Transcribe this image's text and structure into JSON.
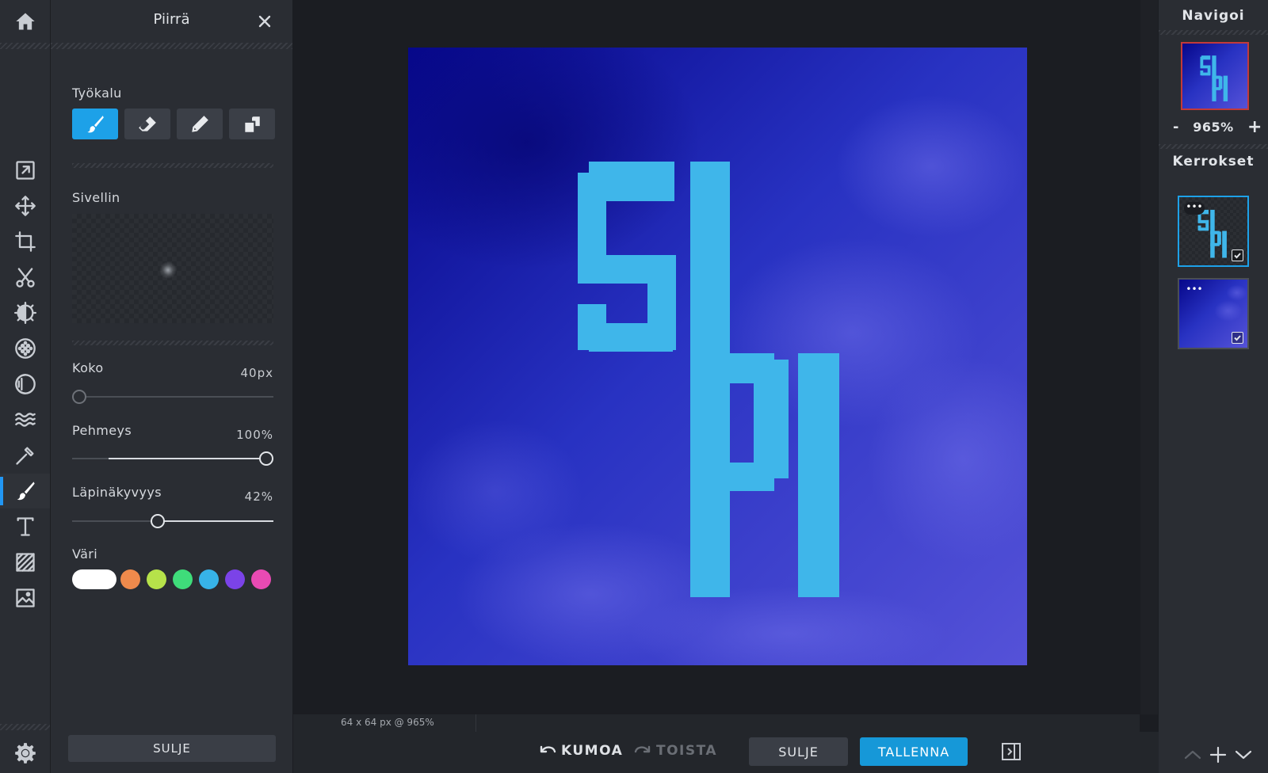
{
  "panel": {
    "title": "Piirrä",
    "tool_label": "Työkalu",
    "brush_label": "Sivellin",
    "size_label": "Koko",
    "size_value": "40px",
    "size_fraction": 0.0,
    "softness_label": "Pehmeys",
    "softness_value": "100%",
    "softness_fraction": 1.0,
    "opacity_label": "Läpinäkyvyys",
    "opacity_value": "42%",
    "opacity_fraction": 0.42,
    "color_label": "Väri",
    "colors": [
      "#ffffff",
      "#ef8a4c",
      "#b6e24a",
      "#3fdc7a",
      "#37b3e8",
      "#7b43e8",
      "#e94ab3"
    ],
    "close_button": "SULJE"
  },
  "toolbar": {
    "active_tool": "draw",
    "items": [
      "home-icon",
      "export-icon",
      "move-icon",
      "crop-icon",
      "cut-icon",
      "adjust-icon",
      "filter-icon",
      "effect-icon",
      "liquify-icon",
      "retouch-icon",
      "draw-icon",
      "text-icon",
      "pattern-icon",
      "image-icon",
      "settings-icon"
    ]
  },
  "canvas": {
    "status": "64 x 64 px @ 965%",
    "text": "SPI",
    "text_color": "#3fb6ea",
    "background_colors": [
      "#0a0f8a",
      "#2e3ccc",
      "#5150d6"
    ]
  },
  "bottombar": {
    "undo": "KUMOA",
    "redo": "TOISTA",
    "close": "SULJE",
    "save": "TALLENNA"
  },
  "rightpanel": {
    "navigate_title": "Navigoi",
    "zoom_minus": "-",
    "zoom_value": "965%",
    "zoom_plus": "+",
    "layers_title": "Kerrokset",
    "layer_menu": "•••"
  }
}
